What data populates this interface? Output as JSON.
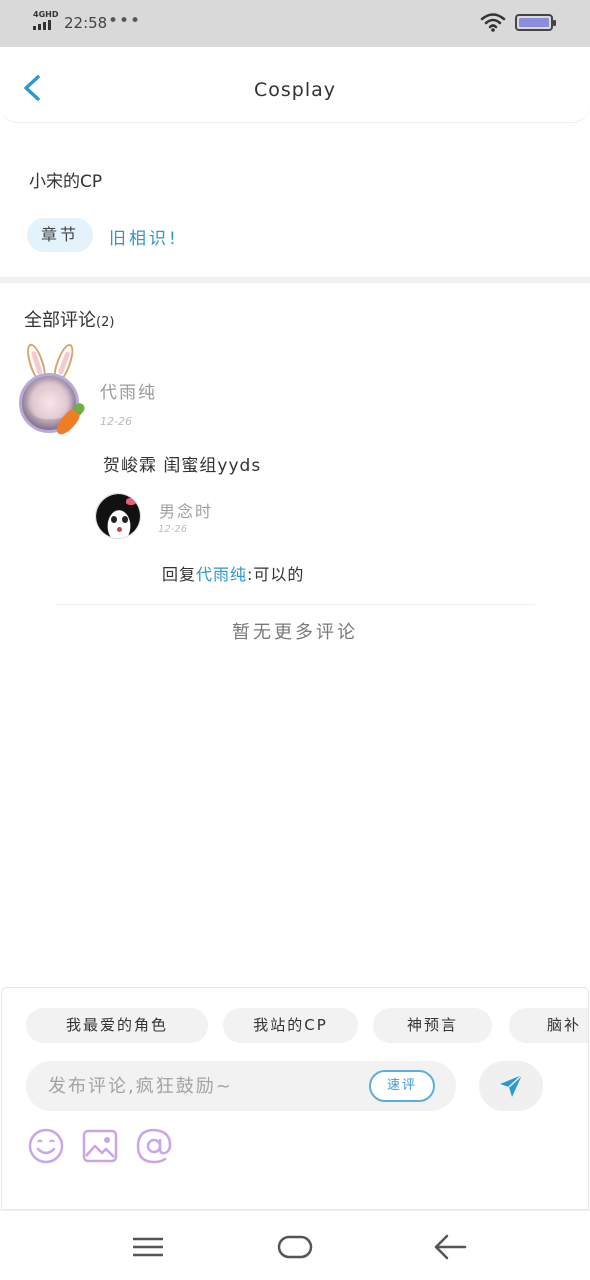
{
  "status_bar": {
    "network": "4GHD",
    "time": "22:58",
    "dots": "•••"
  },
  "header": {
    "title": "Cosplay"
  },
  "work": {
    "title": "小宋的CP",
    "chapter_tag": "章节",
    "chapter_name": "旧相识!"
  },
  "comments": {
    "heading": "全部评论",
    "count": "(2)",
    "items": [
      {
        "user": "代雨纯",
        "date": "12-26",
        "text": "贺峻霖 闺蜜组yyds",
        "replies": [
          {
            "user": "男念时",
            "date": "12-26",
            "prefix": "回复",
            "mention": "代雨纯",
            "text": ":可以的"
          }
        ]
      }
    ],
    "no_more": "暂无更多评论"
  },
  "composer": {
    "chips": [
      "我最爱的角色",
      "我站的CP",
      "神预言",
      "脑补"
    ],
    "placeholder": "发布评论,疯狂鼓励~",
    "quick_label": "速评"
  },
  "colors": {
    "accent": "#2f97cf",
    "icon_purple": "#c9a6e8"
  }
}
